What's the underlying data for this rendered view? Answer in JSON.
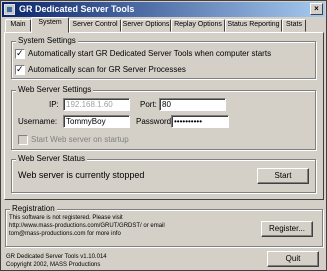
{
  "window": {
    "title": "GR Dedicated Server Tools",
    "close_glyph": "×"
  },
  "tabs": [
    "Main",
    "System",
    "Server Control",
    "Server Options",
    "Replay Options",
    "Status Reporting",
    "Stats"
  ],
  "system_settings": {
    "title": "System Settings",
    "auto_start": {
      "label": "Automatically start GR Dedicated Server Tools when computer starts",
      "checked": true
    },
    "auto_scan": {
      "label": "Automatically scan for GR Server Processes",
      "checked": true
    }
  },
  "web_server_settings": {
    "title": "Web Server Settings",
    "ip_label": "IP:",
    "ip_value": "192.168.1.60",
    "port_label": "Port:",
    "port_value": "80",
    "username_label": "Username:",
    "username_value": "TommyBoy",
    "password_label": "Password:",
    "password_value": "••••••••••",
    "start_on_startup": {
      "label": "Start Web server on startup",
      "checked": false
    }
  },
  "web_server_status": {
    "title": "Web Server Status",
    "status_text": "Web server is currently stopped",
    "start_label": "Start"
  },
  "registration": {
    "title": "Registration",
    "line1": "This software is not registered. Please visit",
    "line2": "http://www.mass-productions.com/GRUT/GRDST/ or email",
    "line3": "tom@mass-productions.com for more info",
    "register_label": "Register..."
  },
  "footer": {
    "version": "GR Dedicated Server Tools v1.10.014",
    "copyright": "Copyright 2002, MASS Productions",
    "quit_label": "Quit"
  }
}
